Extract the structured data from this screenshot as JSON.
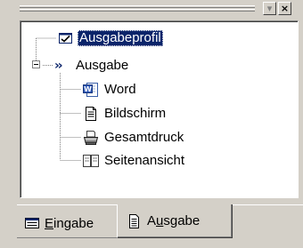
{
  "toolbar": {
    "dropdown_glyph": "▾",
    "close_glyph": "×"
  },
  "tree": {
    "nodes": [
      {
        "label": "Ausgabeprofil",
        "icon": "checkbox-window-icon",
        "selected": true
      },
      {
        "label": "Ausgabe",
        "icon": "double-chevron-icon",
        "expanded": true
      },
      {
        "label": "Word",
        "icon": "word-document-icon"
      },
      {
        "label": "Bildschirm",
        "icon": "document-page-icon"
      },
      {
        "label": "Gesamtdruck",
        "icon": "printer-icon"
      },
      {
        "label": "Seitenansicht",
        "icon": "page-preview-icon"
      }
    ]
  },
  "tabs": {
    "eingabe": {
      "pre": "",
      "accel": "E",
      "post": "ingabe",
      "icon": "input-form-icon",
      "active": false
    },
    "ausgabe": {
      "pre": "A",
      "accel": "u",
      "post": "sgabe",
      "icon": "output-document-icon",
      "active": true
    }
  },
  "colors": {
    "face": "#d4d0c8",
    "selection": "#0a246a",
    "chevron": "#0a246a"
  }
}
